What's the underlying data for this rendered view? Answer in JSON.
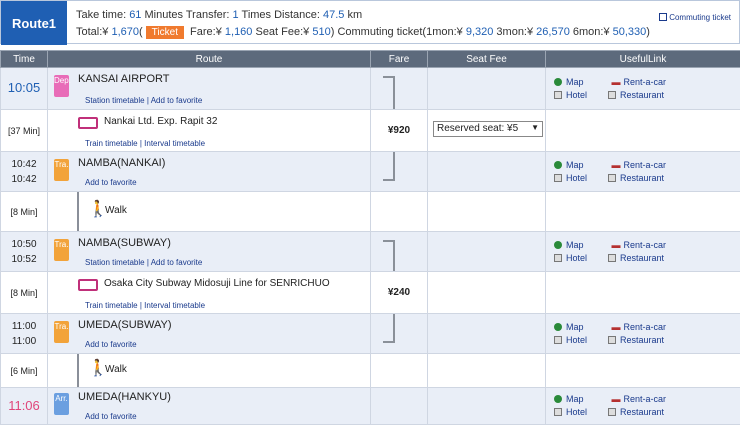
{
  "route": {
    "tab": "Route1",
    "line1_pre": "Take time: ",
    "time_val": "61",
    "line1_b": " Minutes  Transfer: ",
    "transfer_val": "1",
    "line1_c": " Times  Distance: ",
    "dist_val": "47.5",
    "line1_d": " km",
    "line2_pre": "Total:¥ ",
    "total_val": "1,670",
    "paren": "(",
    "ticket": "Ticket",
    "fare_lbl": " Fare:¥ ",
    "fare_val": "1,160",
    "seat_lbl": "  Seat Fee:¥ ",
    "seat_val": "510",
    "comm_lbl": ")  Commuting ticket(1mon:¥ ",
    "m1": "9,320",
    "m3_lbl": "  3mon:¥ ",
    "m3": "26,570",
    "m6_lbl": "  6mon:¥ ",
    "m6": "50,330",
    "close": ")",
    "commuting_link": "Commuting ticket"
  },
  "headers": [
    "Time",
    "Route",
    "Fare",
    "Seat Fee",
    "UsefulLink"
  ],
  "links": {
    "map": "Map",
    "car": "Rent-a-car",
    "hotel": "Hotel",
    "rest": "Restaurant",
    "timetable": "Station timetable",
    "favorite": "Add to favorite",
    "sep": " | ",
    "tt": "Train timetable",
    "itt": "Interval timetable"
  },
  "stations": [
    {
      "time": "10:05",
      "badge": "Dep.",
      "name": "KANSAI AIRPORT"
    },
    {
      "time1": "10:42",
      "time2": "10:42",
      "badge": "Tra.",
      "name": "NAMBA(NANKAI)"
    },
    {
      "time1": "10:50",
      "time2": "10:52",
      "badge": "Tra.",
      "name": "NAMBA(SUBWAY)"
    },
    {
      "time1": "11:00",
      "time2": "11:00",
      "badge": "Tra.",
      "name": "UMEDA(SUBWAY)"
    },
    {
      "time": "11:06",
      "badge": "Arr.",
      "name": "UMEDA(HANKYU)"
    }
  ],
  "moves": [
    {
      "dur": "[37 Min]",
      "name": "Nankai Ltd. Exp. Rapit 32",
      "fare": "¥920",
      "seat": "Reserved seat: ¥5"
    },
    {
      "dur": "[8 Min]",
      "name": "Walk"
    },
    {
      "dur": "[8 Min]",
      "name": "Osaka City Subway Midosuji Line  for SENRICHUO",
      "fare": "¥240"
    },
    {
      "dur": "[6 Min]",
      "name": "Walk"
    }
  ],
  "colors": {
    "accent": "#1f5fb3",
    "ticket": "#f07a2e",
    "arrival": "#e0457a"
  }
}
